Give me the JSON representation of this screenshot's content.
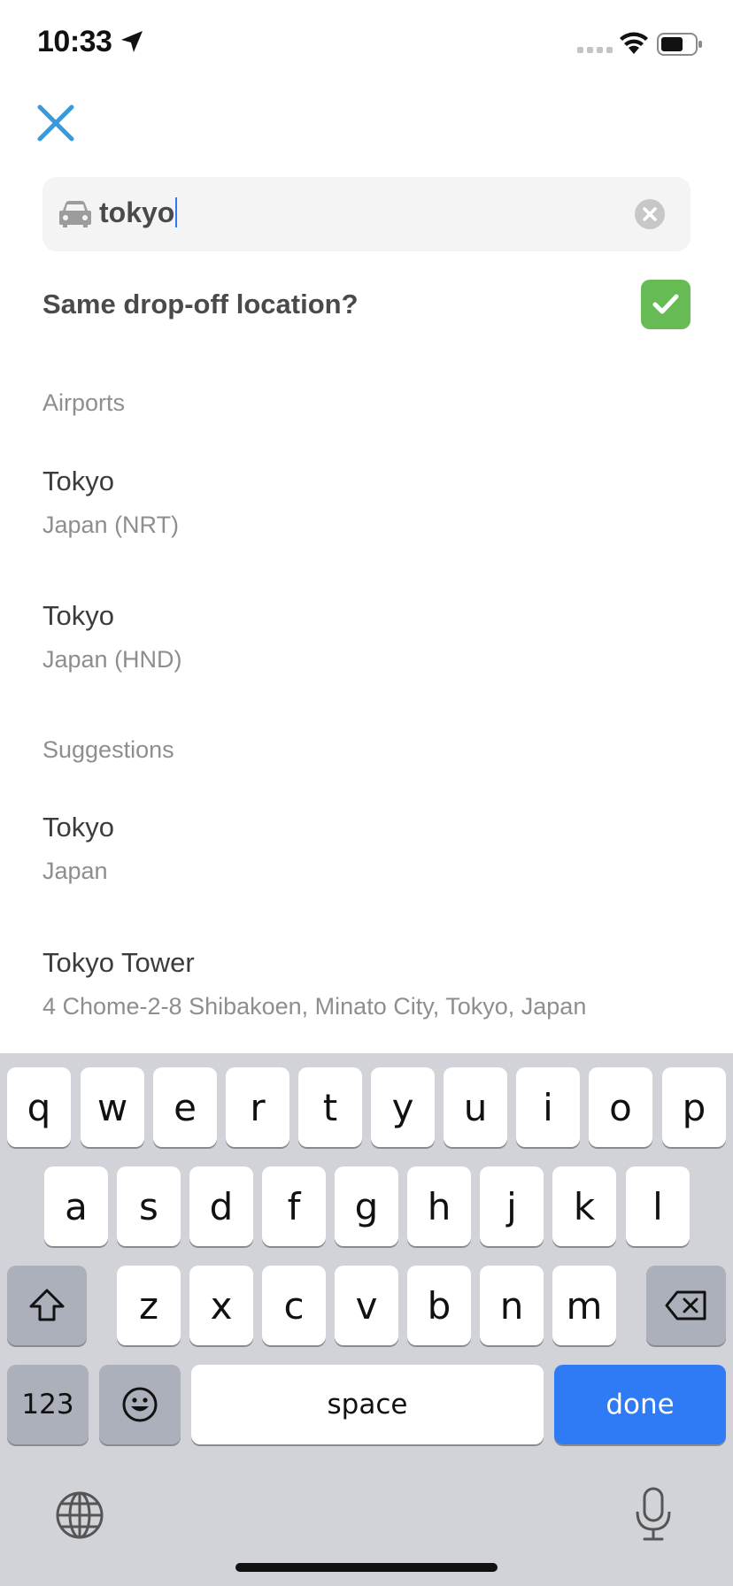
{
  "status": {
    "time": "10:33",
    "icons": [
      "location-arrow-icon",
      "signal-icon",
      "wifi-icon",
      "battery-icon"
    ]
  },
  "search": {
    "value": "tokyo",
    "icon": "car-icon"
  },
  "dropoff": {
    "label": "Same drop-off location?",
    "checked": true
  },
  "sections": {
    "airports": {
      "header": "Airports",
      "items": [
        {
          "title": "Tokyo",
          "subtitle": "Japan (NRT)"
        },
        {
          "title": "Tokyo",
          "subtitle": "Japan (HND)"
        }
      ]
    },
    "suggestions": {
      "header": "Suggestions",
      "items": [
        {
          "title": "Tokyo",
          "subtitle": "Japan"
        },
        {
          "title": "Tokyo Tower",
          "subtitle": "4 Chome-2-8 Shibakoen, Minato City, Tokyo, Japan"
        }
      ]
    }
  },
  "keyboard": {
    "row1": [
      "q",
      "w",
      "e",
      "r",
      "t",
      "y",
      "u",
      "i",
      "o",
      "p"
    ],
    "row2": [
      "a",
      "s",
      "d",
      "f",
      "g",
      "h",
      "j",
      "k",
      "l"
    ],
    "row3": [
      "z",
      "x",
      "c",
      "v",
      "b",
      "n",
      "m"
    ],
    "numbers_label": "123",
    "space_label": "space",
    "done_label": "done"
  },
  "colors": {
    "accent_blue": "#2f7bf5",
    "check_green": "#66bb55",
    "close_blue": "#3a9ad9"
  }
}
